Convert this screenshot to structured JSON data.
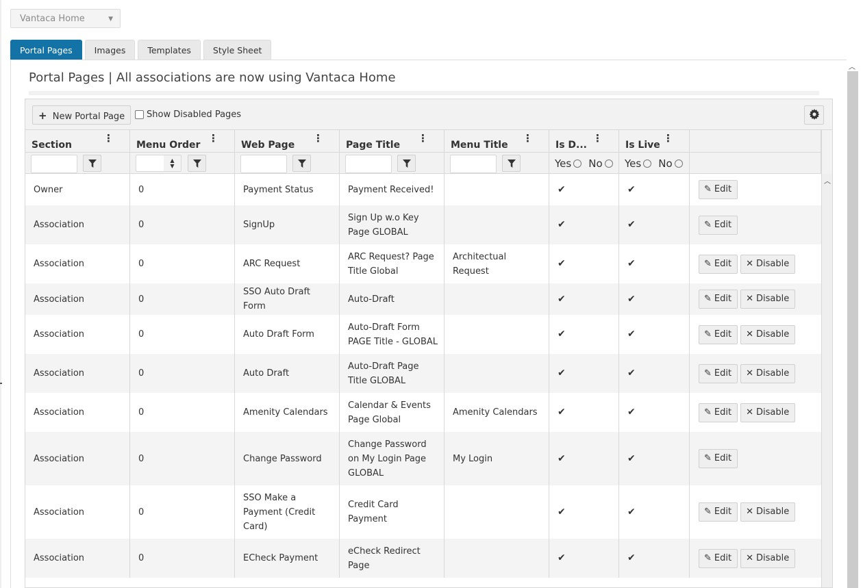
{
  "site_select": {
    "value": "Vantaca Home",
    "caret_icon": "caret-down-icon"
  },
  "tabs": [
    {
      "label": "Portal Pages",
      "active": true
    },
    {
      "label": "Images",
      "active": false
    },
    {
      "label": "Templates",
      "active": false
    },
    {
      "label": "Style Sheet",
      "active": false
    }
  ],
  "page_heading": "Portal Pages | All associations are now using Vantaca Home",
  "toolbar": {
    "new_button_icon": "+",
    "new_button_label": "New Portal Page",
    "show_disabled_label": "Show Disabled Pages",
    "show_disabled_checked": false,
    "settings_icon": "gear-icon"
  },
  "columns": [
    {
      "title": "Section",
      "filter": "text"
    },
    {
      "title": "Menu Order",
      "filter": "number"
    },
    {
      "title": "Web Page",
      "filter": "text"
    },
    {
      "title": "Page Title",
      "filter": "text"
    },
    {
      "title": "Menu Title",
      "filter": "text"
    },
    {
      "title": "Is D...",
      "filter": "boolean"
    },
    {
      "title": "Is Live",
      "filter": "boolean"
    }
  ],
  "boolean_filter": {
    "yes": "Yes",
    "no": "No"
  },
  "actions": {
    "edit": "Edit",
    "disable": "Disable"
  },
  "rows": [
    {
      "section": "Owner",
      "menu_order": "0",
      "web_page": "Payment Status",
      "page_title": "Payment Received!",
      "menu_title": "",
      "is_default": true,
      "is_live": true,
      "can_disable": false
    },
    {
      "section": "Association",
      "menu_order": "0",
      "web_page": "SignUp",
      "page_title": "Sign Up w.o Key Page GLOBAL",
      "menu_title": "",
      "is_default": true,
      "is_live": true,
      "can_disable": false
    },
    {
      "section": "Association",
      "menu_order": "0",
      "web_page": "ARC Request",
      "page_title": "ARC Request? Page Title Global",
      "menu_title": "Architectual Request",
      "is_default": true,
      "is_live": true,
      "can_disable": true
    },
    {
      "section": "Association",
      "menu_order": "0",
      "web_page": "SSO Auto Draft Form",
      "page_title": "Auto-Draft",
      "menu_title": "",
      "is_default": true,
      "is_live": true,
      "can_disable": true
    },
    {
      "section": "Association",
      "menu_order": "0",
      "web_page": "Auto Draft Form",
      "page_title": "Auto-Draft Form PAGE Title - GLOBAL",
      "menu_title": "",
      "is_default": true,
      "is_live": true,
      "can_disable": true
    },
    {
      "section": "Association",
      "menu_order": "0",
      "web_page": "Auto Draft",
      "page_title": "Auto-Draft Page Title GLOBAL",
      "menu_title": "",
      "is_default": true,
      "is_live": true,
      "can_disable": true
    },
    {
      "section": "Association",
      "menu_order": "0",
      "web_page": "Amenity Calendars",
      "page_title": "Calendar & Events Page Global",
      "menu_title": "Amenity Calendars",
      "is_default": true,
      "is_live": true,
      "can_disable": true
    },
    {
      "section": "Association",
      "menu_order": "0",
      "web_page": "Change Password",
      "page_title": "Change Password on My Login Page GLOBAL",
      "menu_title": "My Login",
      "is_default": true,
      "is_live": true,
      "can_disable": false
    },
    {
      "section": "Association",
      "menu_order": "0",
      "web_page": "SSO Make a Payment (Credit Card)",
      "page_title": "Credit Card Payment",
      "menu_title": "",
      "is_default": true,
      "is_live": true,
      "can_disable": true
    },
    {
      "section": "Association",
      "menu_order": "0",
      "web_page": "ECheck Payment",
      "page_title": "eCheck Redirect Page",
      "menu_title": "",
      "is_default": true,
      "is_live": true,
      "can_disable": true
    }
  ]
}
